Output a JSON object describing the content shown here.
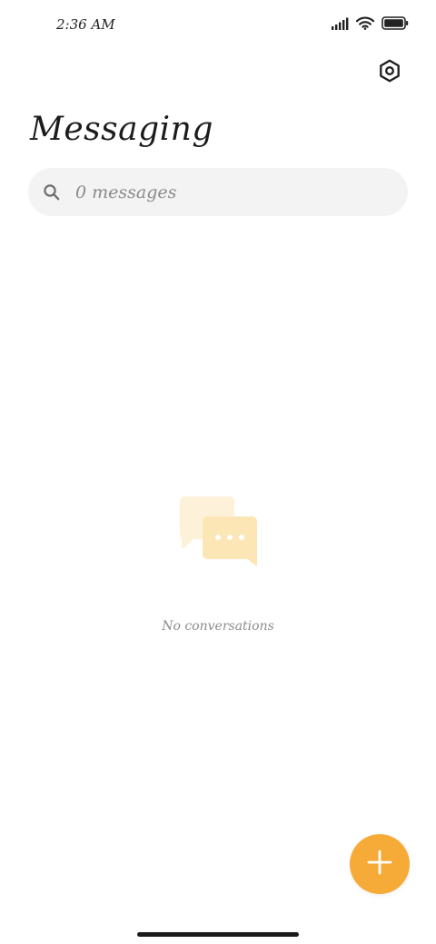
{
  "status_bar": {
    "time": "2:36 AM",
    "icons": [
      "signal-icon",
      "wifi-icon",
      "battery-icon"
    ]
  },
  "header": {
    "title": "Messaging",
    "settings_icon": "settings-icon"
  },
  "search": {
    "placeholder": "0 messages",
    "value": "",
    "icon": "search-icon"
  },
  "empty_state": {
    "icon": "chat-bubbles-icon",
    "message": "No conversations"
  },
  "fab": {
    "icon": "plus-icon"
  },
  "colors": {
    "accent": "#f6aa38",
    "search_background": "#f3f3f3",
    "illustration_light": "#fdf1d9",
    "illustration_dark": "#fce6b6"
  }
}
